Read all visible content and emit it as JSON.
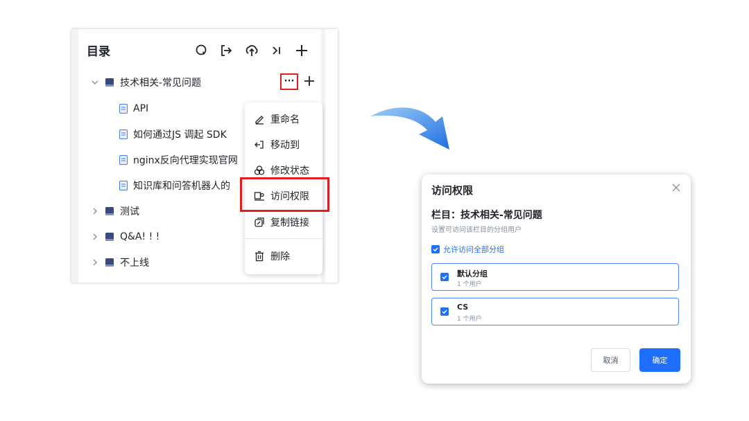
{
  "directory": {
    "title": "目录",
    "header_icons": [
      "search-icon",
      "export-icon",
      "upload-icon",
      "collapse-icon",
      "add-icon"
    ],
    "tree": [
      {
        "label": "技术相关-常见问题",
        "type": "book",
        "expanded": true
      },
      {
        "label": "API",
        "type": "doc"
      },
      {
        "label": "如何通过JS 调起 SDK",
        "type": "doc"
      },
      {
        "label": "nginx反向代理实现官网",
        "type": "doc"
      },
      {
        "label": "知识库和问答机器人的",
        "type": "doc"
      },
      {
        "label": "测试",
        "type": "book",
        "expanded": false
      },
      {
        "label": "Q&A! ! !",
        "type": "book",
        "expanded": false
      },
      {
        "label": "不上线",
        "type": "book",
        "expanded": false
      }
    ],
    "more_label": "···",
    "add_label": "+"
  },
  "context_menu": {
    "items": [
      {
        "label": "重命名",
        "icon": "edit-icon"
      },
      {
        "label": "移动到",
        "icon": "move-icon"
      },
      {
        "label": "修改状态",
        "icon": "status-icon"
      },
      {
        "label": "访问权限",
        "icon": "permission-icon",
        "highlighted": true
      },
      {
        "label": "复制链接",
        "icon": "copy-link-icon"
      },
      {
        "label": "删除",
        "icon": "trash-icon"
      }
    ]
  },
  "dialog": {
    "title": "访问权限",
    "column_prefix": "栏目：",
    "column_name": "技术相关-常见问题",
    "hint": "设置可访问该栏目的分组用户",
    "allow_all_label": "允许访问全部分组",
    "groups": [
      {
        "name": "默认分组",
        "count": "1 个用户",
        "checked": true
      },
      {
        "name": "CS",
        "count": "1 个用户",
        "checked": true
      }
    ],
    "cancel_label": "取消",
    "ok_label": "确定"
  },
  "colors": {
    "accent": "#1e6fff",
    "highlight_red": "#e02020",
    "arrow_blue": "#2f86e8"
  }
}
